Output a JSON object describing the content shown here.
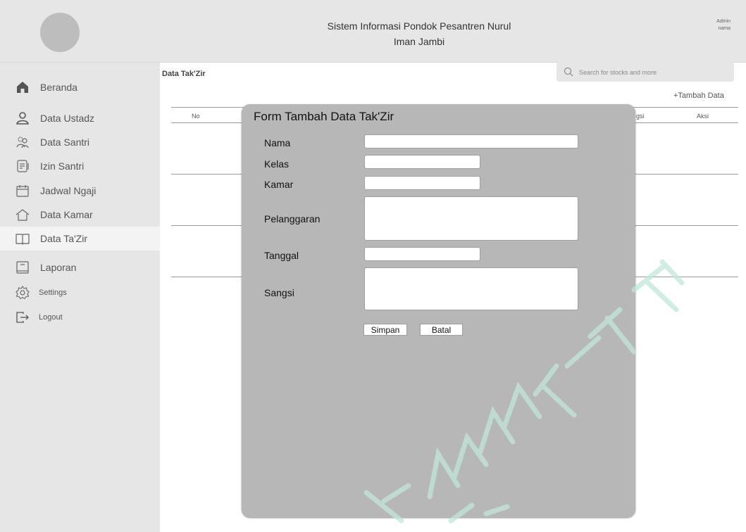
{
  "header": {
    "title_line1": "Sistem Informasi Pondok Pesantren Nurul",
    "title_line2": "Iman Jambi",
    "admin_label": "Admin",
    "admin_name": "nama"
  },
  "sidebar": {
    "items": [
      {
        "label": "Beranda",
        "icon": "home-icon"
      },
      {
        "label": "Data Ustadz",
        "icon": "user-icon"
      },
      {
        "label": "Data Santri",
        "icon": "users-icon"
      },
      {
        "label": "Izin Santri",
        "icon": "document-icon"
      },
      {
        "label": "Jadwal Ngaji",
        "icon": "calendar-icon"
      },
      {
        "label": "Data Kamar",
        "icon": "house-outline-icon"
      },
      {
        "label": "Data Ta'Zir",
        "icon": "book-icon"
      },
      {
        "label": "Laporan",
        "icon": "report-icon"
      },
      {
        "label": "Settings",
        "icon": "gear-icon"
      },
      {
        "label": "Logout",
        "icon": "logout-icon"
      }
    ],
    "active": "Data Ta'Zir"
  },
  "main": {
    "title": "Data Tak'Zir",
    "search_placeholder": "Search for stocks and more",
    "add_button": "+Tambah Data",
    "table_headers": {
      "no": "No",
      "sangsi_partial": "gsi",
      "aksi": "Aksi"
    }
  },
  "modal": {
    "title": "Form Tambah Data Tak'Zir",
    "fields": {
      "nama": "Nama",
      "kelas": "Kelas",
      "kamar": "Kamar",
      "pelanggaran": "Pelanggaran",
      "tanggal": "Tanggal",
      "sangsi": "Sangsi"
    },
    "save_button": "Simpan",
    "cancel_button": "Batal"
  },
  "colors": {
    "panel_gray": "#e6e6e6",
    "modal_gray": "#b7b7b7",
    "watermark": "#bfe8d9"
  }
}
